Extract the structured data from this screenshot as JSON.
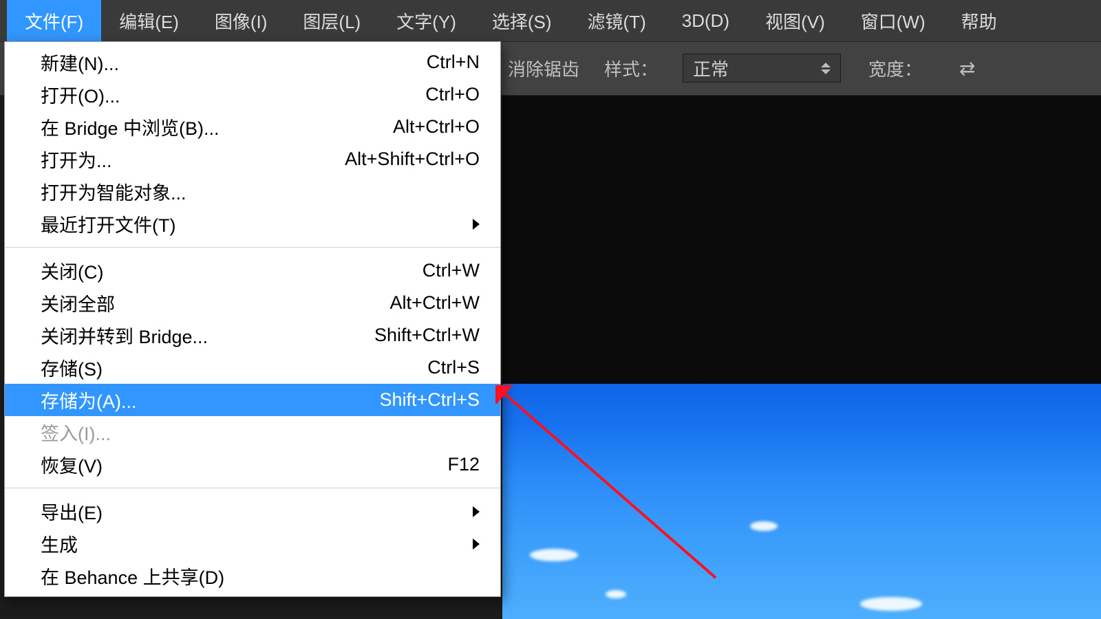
{
  "menubar": {
    "items": [
      {
        "label": "文件(F)"
      },
      {
        "label": "编辑(E)"
      },
      {
        "label": "图像(I)"
      },
      {
        "label": "图层(L)"
      },
      {
        "label": "文字(Y)"
      },
      {
        "label": "选择(S)"
      },
      {
        "label": "滤镜(T)"
      },
      {
        "label": "3D(D)"
      },
      {
        "label": "视图(V)"
      },
      {
        "label": "窗口(W)"
      },
      {
        "label": "帮助"
      }
    ]
  },
  "optbar": {
    "antialias": "消除锯齿",
    "style_label": "样式：",
    "style_value": "正常",
    "width_label": "宽度："
  },
  "file_menu": {
    "groups": [
      [
        {
          "label": "新建(N)...",
          "shortcut": "Ctrl+N"
        },
        {
          "label": "打开(O)...",
          "shortcut": "Ctrl+O"
        },
        {
          "label": "在 Bridge 中浏览(B)...",
          "shortcut": "Alt+Ctrl+O"
        },
        {
          "label": "打开为...",
          "shortcut": "Alt+Shift+Ctrl+O"
        },
        {
          "label": "打开为智能对象...",
          "shortcut": ""
        },
        {
          "label": "最近打开文件(T)",
          "shortcut": "",
          "submenu": true
        }
      ],
      [
        {
          "label": "关闭(C)",
          "shortcut": "Ctrl+W"
        },
        {
          "label": "关闭全部",
          "shortcut": "Alt+Ctrl+W"
        },
        {
          "label": "关闭并转到 Bridge...",
          "shortcut": "Shift+Ctrl+W"
        },
        {
          "label": "存储(S)",
          "shortcut": "Ctrl+S"
        },
        {
          "label": "存储为(A)...",
          "shortcut": "Shift+Ctrl+S",
          "selected": true
        },
        {
          "label": "签入(I)...",
          "shortcut": "",
          "disabled": true
        },
        {
          "label": "恢复(V)",
          "shortcut": "F12"
        }
      ],
      [
        {
          "label": "导出(E)",
          "shortcut": "",
          "submenu": true
        },
        {
          "label": "生成",
          "shortcut": "",
          "submenu": true
        },
        {
          "label": "在 Behance 上共享(D)",
          "shortcut": ""
        }
      ]
    ]
  },
  "annotation": {
    "color": "#ff1020"
  }
}
